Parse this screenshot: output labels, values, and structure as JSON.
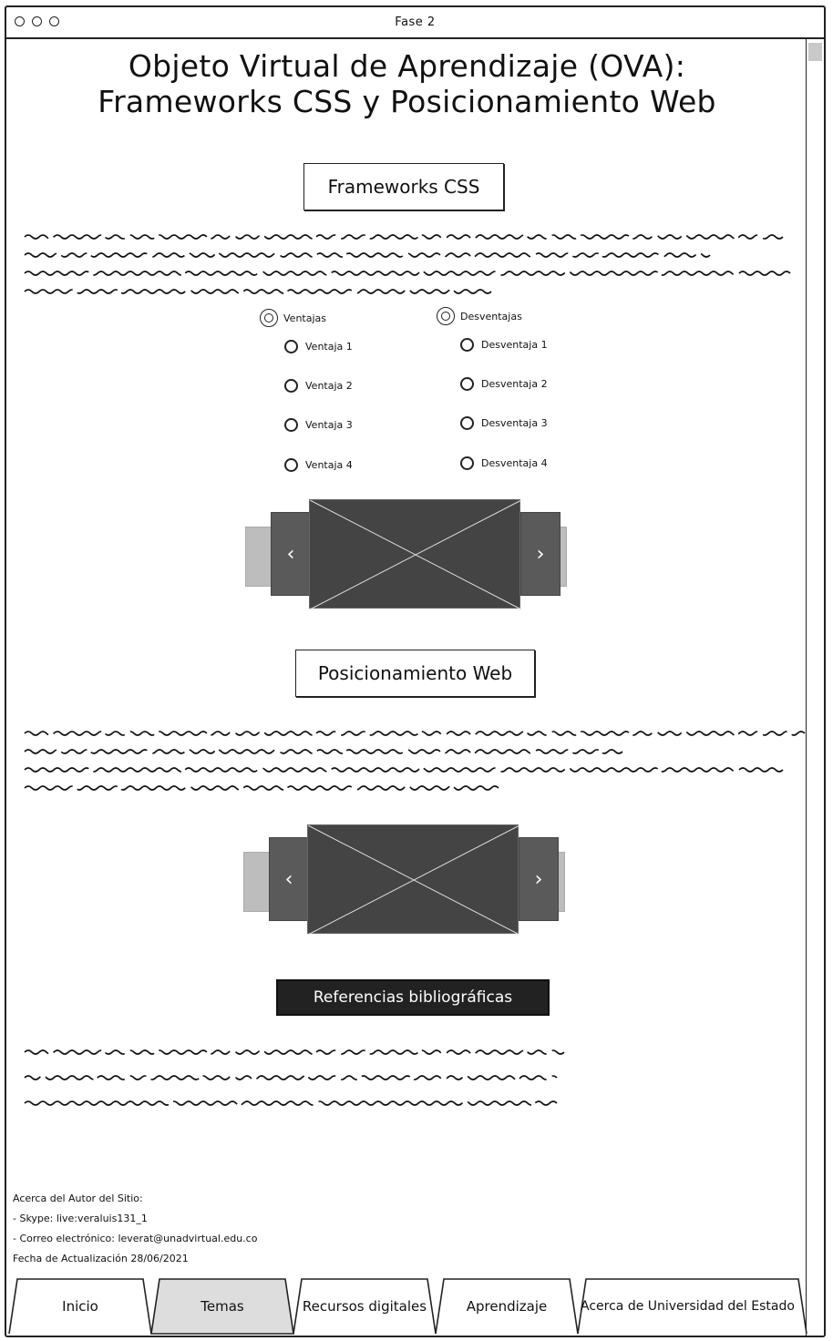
{
  "window": {
    "title": "Fase 2"
  },
  "page": {
    "title_line1": "Objeto Virtual de Aprendizaje (OVA):",
    "title_line2": "Frameworks CSS y Posicionamiento Web"
  },
  "section_frameworks": {
    "heading": "Frameworks CSS",
    "ventajas_label": "Ventajas",
    "desventajas_label": "Desventajas",
    "ventajas": [
      "Ventaja 1",
      "Ventaja 2",
      "Ventaja 3",
      "Ventaja 4"
    ],
    "desventajas": [
      "Desventaja 1",
      "Desventaja 2",
      "Desventaja 3",
      "Desventaja 4"
    ],
    "carousel_prev": "‹",
    "carousel_next": "›"
  },
  "section_posicionamiento": {
    "heading": "Posicionamiento Web",
    "carousel_prev": "‹",
    "carousel_next": "›"
  },
  "references": {
    "button_label": "Referencias bibliográficas"
  },
  "footer": {
    "line1": "Acerca del Autor del Sitio:",
    "line2": "- Skype: live:veraluis131_1",
    "line3": "- Correo electrónico: leverat@unadvirtual.edu.co",
    "line4": "Fecha de Actualización 28/06/2021"
  },
  "tabs": [
    {
      "label": "Inicio",
      "selected": false
    },
    {
      "label": "Temas",
      "selected": true
    },
    {
      "label": "Recursos digitales",
      "selected": false
    },
    {
      "label": "Aprendizaje",
      "selected": false
    },
    {
      "label": "Acerca de Universidad del Estado",
      "selected": false
    }
  ],
  "icons": {
    "prev": "chevron-left-icon",
    "next": "chevron-right-icon",
    "placeholder": "image-placeholder-icon"
  },
  "colors": {
    "selected_tab": "#dddddd",
    "dark_button": "#222222",
    "carousel_center": "#444444"
  }
}
